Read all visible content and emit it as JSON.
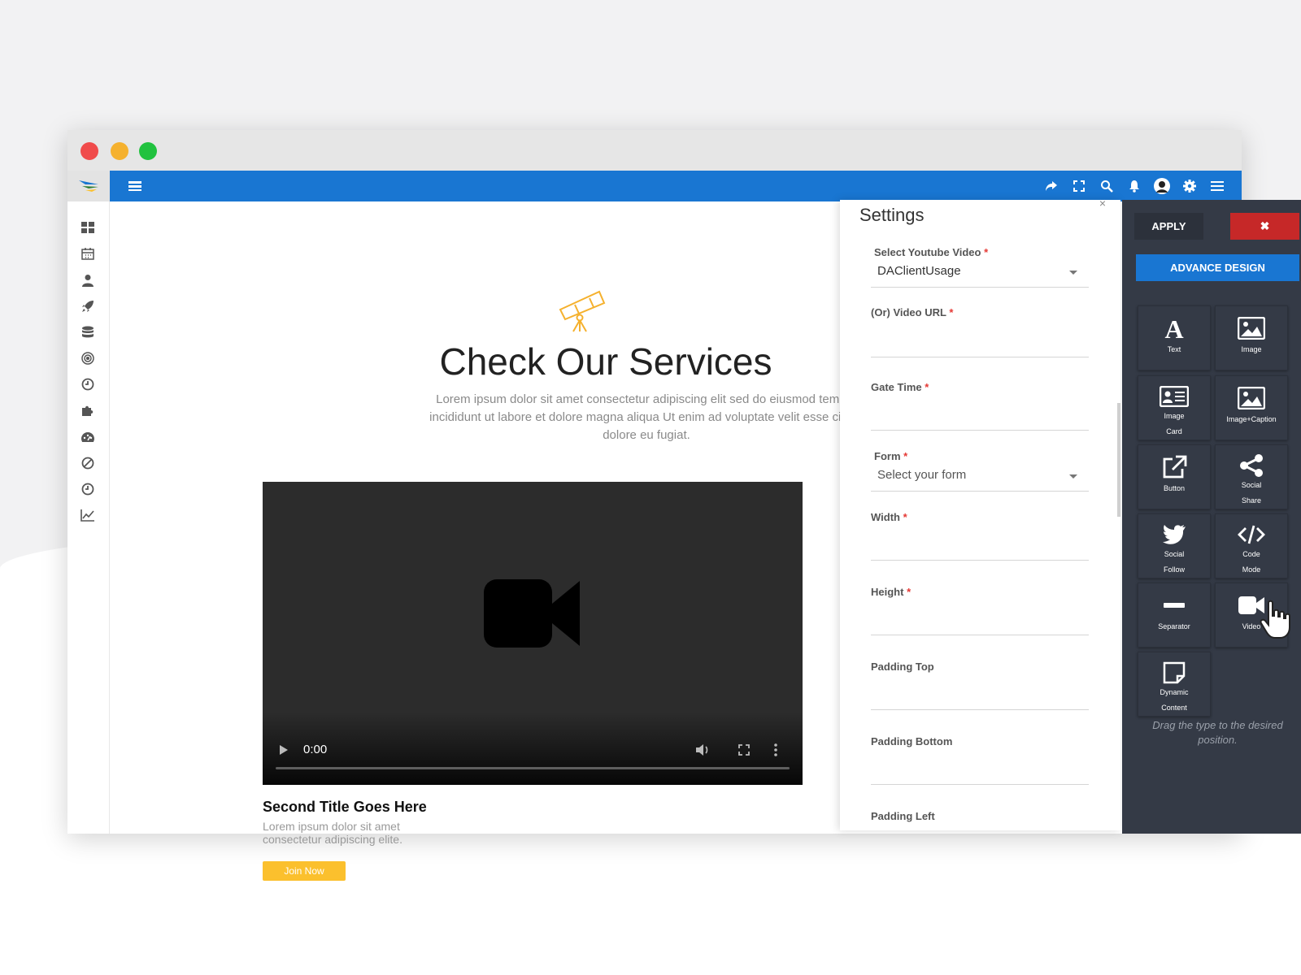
{
  "colors": {
    "topbar": "#1976d2",
    "panel": "#343a46",
    "accent_yellow": "#fbc02d",
    "danger": "#c62828"
  },
  "canvas": {
    "title": "Check Our Services",
    "lead": "Lorem ipsum dolor sit amet consectetur adipiscing elit sed do eiusmod tempor incididunt ut labore et dolore magna aliqua Ut enim ad voluptate velit esse cillum dolore eu fugiat.",
    "video_time": "0:00",
    "second_title": "Second Title Goes Here",
    "second_text": "Lorem ipsum dolor sit amet consectetur adipiscing elite.",
    "join_label": "Join Now"
  },
  "settings": {
    "title": "Settings",
    "close": "×",
    "fields": {
      "youtube": {
        "label": "Select Youtube Video",
        "value": "DAClientUsage"
      },
      "url": {
        "label": "(Or) Video URL"
      },
      "gate": {
        "label": "Gate Time"
      },
      "form": {
        "label": "Form",
        "value": "Select your form"
      },
      "width": {
        "label": "Width"
      },
      "height": {
        "label": "Height"
      },
      "ptop": {
        "label": "Padding Top"
      },
      "pbottom": {
        "label": "Padding Bottom"
      },
      "pleft": {
        "label": "Padding Left"
      }
    },
    "required_mark": "*"
  },
  "panel": {
    "apply": "APPLY",
    "cancel": "✖",
    "advance": "ADVANCE DESIGN",
    "tiles": {
      "text": {
        "l1": "Text"
      },
      "image": {
        "l1": "Image"
      },
      "imagecard": {
        "l1": "Image",
        "l2": "Card"
      },
      "imagecaption": {
        "l1": "Image+Caption"
      },
      "button": {
        "l1": "Button"
      },
      "socialshare": {
        "l1": "Social",
        "l2": "Share"
      },
      "socialfollow": {
        "l1": "Social",
        "l2": "Follow"
      },
      "codemode": {
        "l1": "Code",
        "l2": "Mode"
      },
      "separator": {
        "l1": "Separator"
      },
      "video": {
        "l1": "Video"
      },
      "dynamic": {
        "l1": "Dynamic",
        "l2": "Content"
      }
    },
    "drag_hint": "Drag the type to the desired position."
  }
}
